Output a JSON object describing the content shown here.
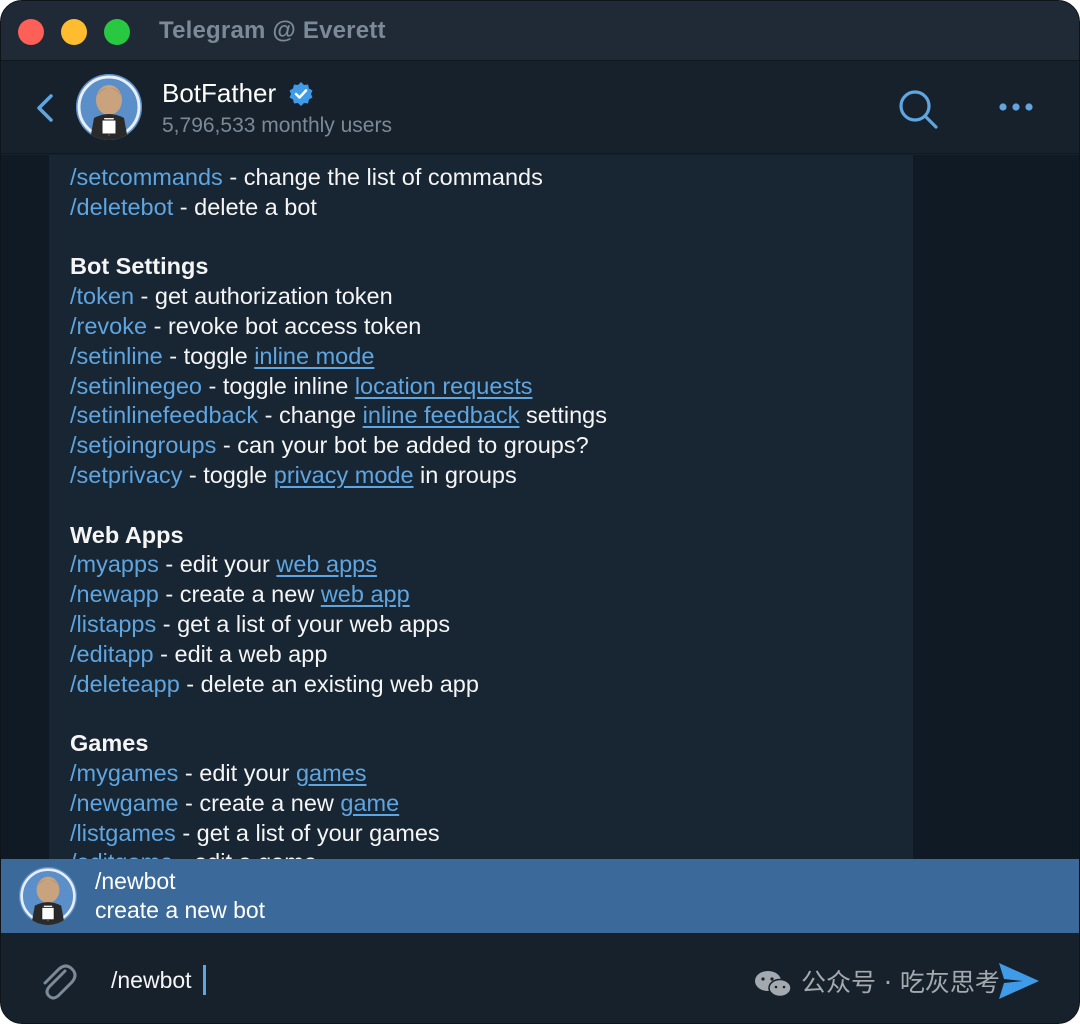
{
  "window": {
    "title": "Telegram @ Everett"
  },
  "header": {
    "name": "BotFather",
    "subtitle": "5,796,533 monthly users"
  },
  "message": {
    "lines": [
      [
        {
          "t": "cmd",
          "v": "/setcommands"
        },
        {
          "t": "text",
          "v": " - change the list of commands"
        }
      ],
      [
        {
          "t": "cmd",
          "v": "/deletebot"
        },
        {
          "t": "text",
          "v": " - delete a bot"
        }
      ],
      [],
      [
        {
          "t": "heading",
          "v": "Bot Settings"
        }
      ],
      [
        {
          "t": "cmd",
          "v": "/token"
        },
        {
          "t": "text",
          "v": " - get authorization token"
        }
      ],
      [
        {
          "t": "cmd",
          "v": "/revoke"
        },
        {
          "t": "text",
          "v": " - revoke bot access token"
        }
      ],
      [
        {
          "t": "cmd",
          "v": "/setinline"
        },
        {
          "t": "text",
          "v": " - toggle "
        },
        {
          "t": "link",
          "v": "inline mode"
        }
      ],
      [
        {
          "t": "cmd",
          "v": "/setinlinegeo"
        },
        {
          "t": "text",
          "v": " - toggle inline "
        },
        {
          "t": "link",
          "v": "location requests"
        }
      ],
      [
        {
          "t": "cmd",
          "v": "/setinlinefeedback"
        },
        {
          "t": "text",
          "v": " - change "
        },
        {
          "t": "link",
          "v": "inline feedback"
        },
        {
          "t": "text",
          "v": " settings"
        }
      ],
      [
        {
          "t": "cmd",
          "v": "/setjoingroups"
        },
        {
          "t": "text",
          "v": " - can your bot be added to groups?"
        }
      ],
      [
        {
          "t": "cmd",
          "v": "/setprivacy"
        },
        {
          "t": "text",
          "v": " - toggle "
        },
        {
          "t": "link",
          "v": "privacy mode"
        },
        {
          "t": "text",
          "v": " in groups"
        }
      ],
      [],
      [
        {
          "t": "heading",
          "v": "Web Apps"
        }
      ],
      [
        {
          "t": "cmd",
          "v": "/myapps"
        },
        {
          "t": "text",
          "v": " - edit your "
        },
        {
          "t": "link",
          "v": "web apps"
        }
      ],
      [
        {
          "t": "cmd",
          "v": "/newapp"
        },
        {
          "t": "text",
          "v": " - create a new "
        },
        {
          "t": "link",
          "v": "web app"
        }
      ],
      [
        {
          "t": "cmd",
          "v": "/listapps"
        },
        {
          "t": "text",
          "v": " - get a list of your web apps"
        }
      ],
      [
        {
          "t": "cmd",
          "v": "/editapp"
        },
        {
          "t": "text",
          "v": " - edit a web app"
        }
      ],
      [
        {
          "t": "cmd",
          "v": "/deleteapp"
        },
        {
          "t": "text",
          "v": " - delete an existing web app"
        }
      ],
      [],
      [
        {
          "t": "heading",
          "v": "Games"
        }
      ],
      [
        {
          "t": "cmd",
          "v": "/mygames"
        },
        {
          "t": "text",
          "v": " - edit your "
        },
        {
          "t": "link",
          "v": "games"
        }
      ],
      [
        {
          "t": "cmd",
          "v": "/newgame"
        },
        {
          "t": "text",
          "v": " - create a new "
        },
        {
          "t": "link",
          "v": "game"
        }
      ],
      [
        {
          "t": "cmd",
          "v": "/listgames"
        },
        {
          "t": "text",
          "v": " - get a list of your games"
        }
      ],
      [
        {
          "t": "cmd",
          "v": "/editgame"
        },
        {
          "t": "text",
          "v": " - edit a game"
        }
      ]
    ]
  },
  "suggestion": {
    "command": "/newbot",
    "description": "create a new bot"
  },
  "composer": {
    "value": "/newbot",
    "watermark": "公众号 · 吃灰思考"
  },
  "colors": {
    "accent": "#5fa5e0",
    "background": "#17212b",
    "bubble": "#182533",
    "suggestion_bg": "#3b6a9a"
  },
  "icons": {
    "back": "chevron-left-icon",
    "verified": "verified-badge-icon",
    "search": "search-icon",
    "more": "more-dots-icon",
    "attach": "paperclip-icon",
    "send": "send-icon"
  }
}
